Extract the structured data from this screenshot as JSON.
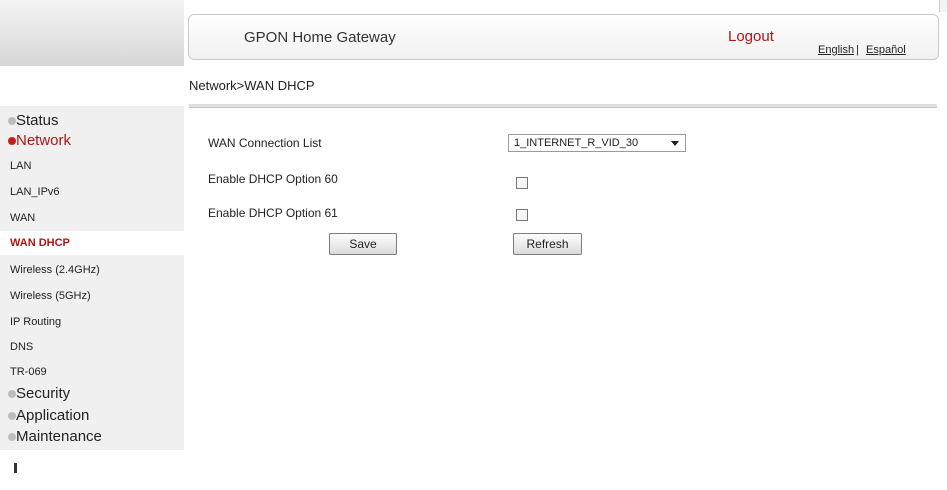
{
  "header": {
    "title": "GPON Home Gateway",
    "logout": "Logout",
    "lang_english": "English",
    "lang_sep": "|",
    "lang_spanish": "Español"
  },
  "breadcrumb": "Network>WAN DHCP",
  "sidebar": {
    "status": "Status",
    "network": "Network",
    "network_items": [
      {
        "label": "LAN"
      },
      {
        "label": "LAN_IPv6"
      },
      {
        "label": "WAN"
      },
      {
        "label": "WAN DHCP"
      },
      {
        "label": "Wireless (2.4GHz)"
      },
      {
        "label": "Wireless (5GHz)"
      },
      {
        "label": "IP Routing"
      },
      {
        "label": "DNS"
      },
      {
        "label": "TR-069"
      }
    ],
    "security": "Security",
    "application": "Application",
    "maintenance": "Maintenance",
    "active_item": "WAN DHCP"
  },
  "form": {
    "wan_list_label": "WAN Connection List",
    "wan_list_value": "1_INTERNET_R_VID_30",
    "opt60_label": "Enable DHCP Option 60",
    "opt60_checked": false,
    "opt61_label": "Enable DHCP Option 61",
    "opt61_checked": false,
    "save_label": "Save",
    "refresh_label": "Refresh"
  },
  "colors": {
    "accent": "#b01515",
    "sidebar_bg": "#f0f0f0"
  }
}
